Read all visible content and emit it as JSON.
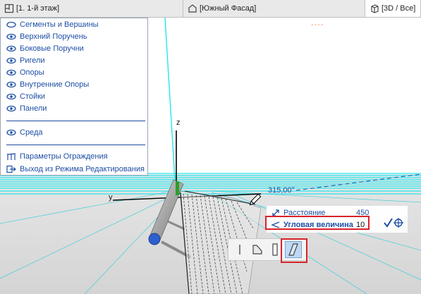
{
  "tabs": [
    {
      "label": "[1. 1-й этаж]",
      "icon": "floor-plan-icon"
    },
    {
      "label": "[Южный Фасад]",
      "icon": "facade-icon"
    },
    {
      "label": "[3D / Все]",
      "icon": "cube-3d-icon"
    }
  ],
  "palette": {
    "items": [
      {
        "label": "Сегменты и Вершины",
        "icon": "eye-closed-icon"
      },
      {
        "label": "Верхний Поручень",
        "icon": "eye-icon"
      },
      {
        "label": "Боковые Поручни",
        "icon": "eye-icon"
      },
      {
        "label": "Ригели",
        "icon": "eye-icon"
      },
      {
        "label": "Опоры",
        "icon": "eye-icon"
      },
      {
        "label": "Внутренние Опоры",
        "icon": "eye-icon"
      },
      {
        "label": "Стойки",
        "icon": "eye-icon"
      },
      {
        "label": "Панели",
        "icon": "eye-icon"
      }
    ],
    "environment": {
      "label": "Среда",
      "icon": "eye-icon"
    },
    "actions": [
      {
        "label": "Параметры Ограждения",
        "icon": "railing-settings-icon"
      },
      {
        "label": "Выход из Режима Редактирования",
        "icon": "exit-edit-icon"
      }
    ]
  },
  "scene": {
    "axis_z": "z",
    "axis_y": "y",
    "angle_readout": "315,00°",
    "dash_mark": "----"
  },
  "tracker": {
    "distance_label": "Расстояние",
    "distance_value": "450",
    "angle_label": "Угловая величина",
    "angle_value": "10"
  },
  "pet_palette": {
    "buttons": [
      "vertical-line-icon",
      "slanted-profile-icon",
      "rect-post-icon",
      "slanted-panel-icon"
    ],
    "selected_index": 3
  },
  "colors": {
    "accent": "#1e4fa5",
    "highlight": "#d8232a",
    "ground_line": "#27e6ee"
  }
}
